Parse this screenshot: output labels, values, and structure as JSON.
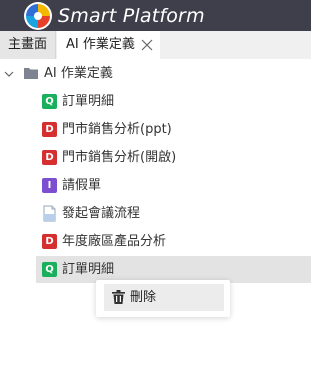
{
  "app": {
    "title": "Smart Platform"
  },
  "tabs": [
    {
      "label": "主畫面"
    },
    {
      "label": "AI 作業定義",
      "active": true
    }
  ],
  "tree": {
    "root_label": "AI 作業定義",
    "items": [
      {
        "badge": "Q",
        "badge_color": "#1aaf5d",
        "label": "訂單明細"
      },
      {
        "badge": "D",
        "badge_color": "#d62f2f",
        "label": "門市銷售分析(ppt)"
      },
      {
        "badge": "D",
        "badge_color": "#d62f2f",
        "label": "門市銷售分析(開啟)"
      },
      {
        "badge": "I",
        "badge_color": "#7b4fd0",
        "label": "請假單"
      },
      {
        "badge": "",
        "icon": "document-icon",
        "label": "發起會議流程"
      },
      {
        "badge": "D",
        "badge_color": "#d62f2f",
        "label": "年度廠區產品分析"
      },
      {
        "badge": "Q",
        "badge_color": "#1aaf5d",
        "label": "訂單明細",
        "selected": true
      }
    ]
  },
  "context_menu": {
    "delete_label": "刪除",
    "icon": "trash-icon"
  },
  "colors": {
    "titlebar": "#3e3f4b",
    "selected_row": "#e3e3e3"
  }
}
